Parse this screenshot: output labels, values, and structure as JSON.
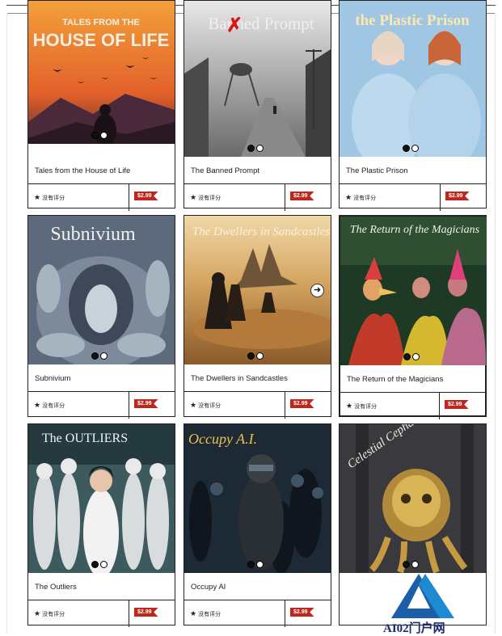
{
  "cards": [
    {
      "title": "Tales from the House of Life",
      "art_title": "TALES FROM THE\nHOUSE OF LIFE",
      "rating": "没有评分",
      "price": "$2.99"
    },
    {
      "title": "The Banned Prompt",
      "art_title": "The Banned Prompt",
      "rating": "没有评分",
      "price": "$2.99"
    },
    {
      "title": "The Plastic Prison",
      "art_title": "the Plastic Prison",
      "rating": "没有评分",
      "price": "$2.99"
    },
    {
      "title": "Subnivium",
      "art_title": "Subnivium",
      "rating": "没有评分",
      "price": "$2.99"
    },
    {
      "title": "The Dwellers in Sandcastles",
      "art_title": "The Dwellers in Sandcastles",
      "rating": "没有评分",
      "price": "$2.99"
    },
    {
      "title": "The Return of the Magicians",
      "art_title": "The Return of the Magicians",
      "rating": "没有评分",
      "price": "$2.99"
    },
    {
      "title": "The Outliers",
      "art_title": "The OUTLIERS",
      "rating": "没有评分",
      "price": "$2.99"
    },
    {
      "title": "Occupy AI",
      "art_title": "Occupy A.I.",
      "rating": "没有评分",
      "price": "$2.99"
    },
    {
      "title": "",
      "art_title": "Celestial Cephalopods",
      "rating": "",
      "price": ""
    }
  ],
  "watermark": {
    "text": "AI02门户网"
  },
  "icons": {
    "star": "star-icon",
    "next": "arrow-right-icon"
  }
}
